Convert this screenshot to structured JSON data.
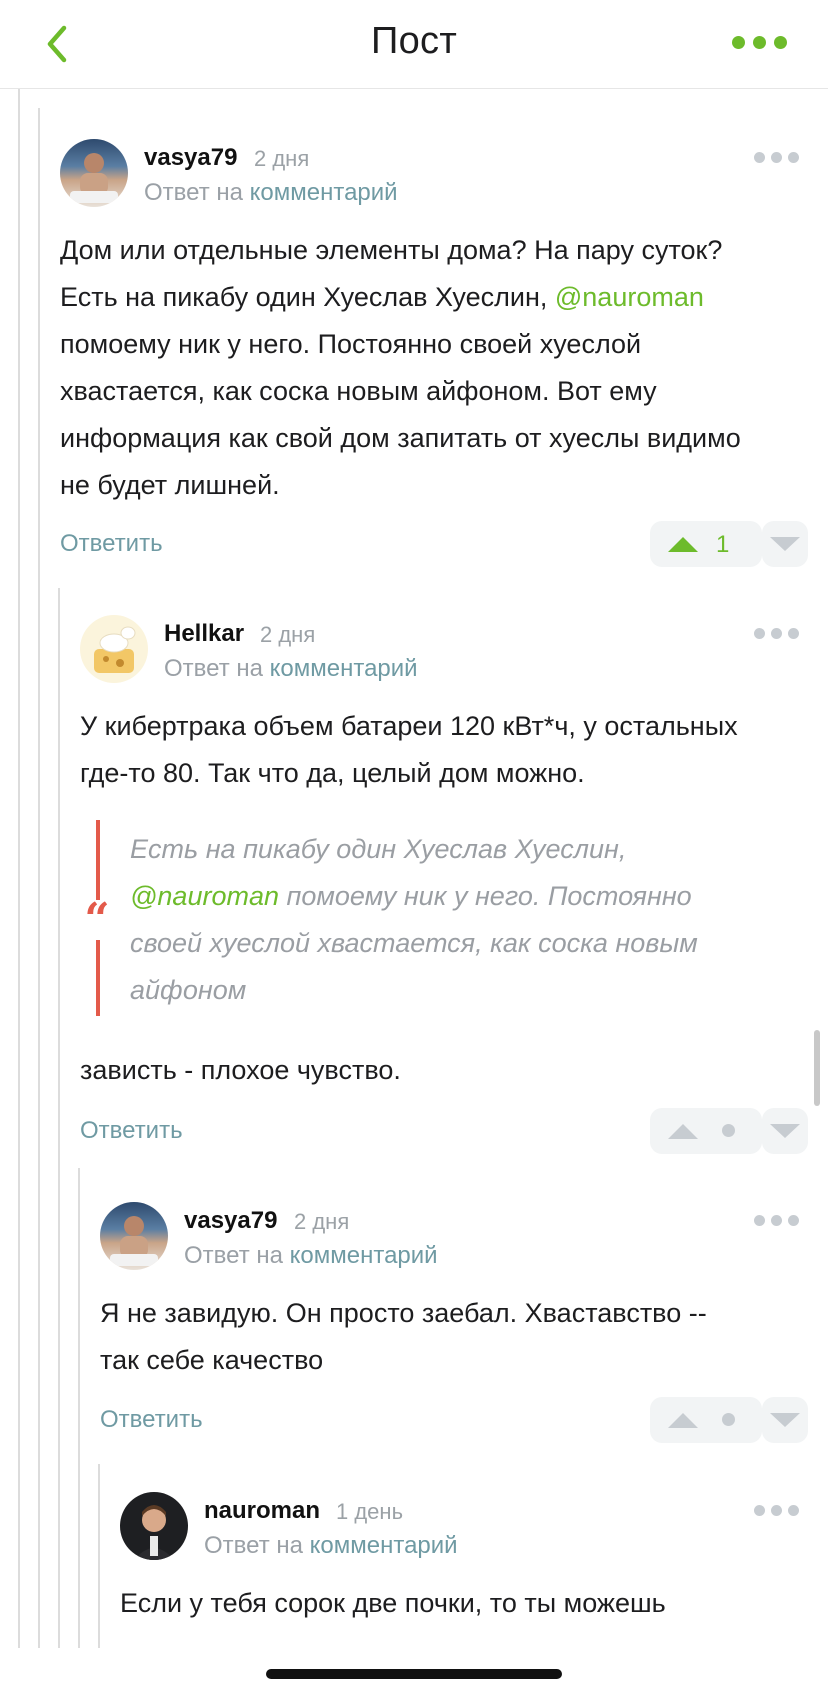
{
  "header": {
    "title": "Пост"
  },
  "colors": {
    "accent": "#6dbb2b",
    "quote_bar": "#e35a4a",
    "link": "#6f9aa3"
  },
  "comments": [
    {
      "username": "vasya79",
      "date": "2 дня",
      "reply_prefix": "Ответ на",
      "reply_link": "комментарий",
      "body_lines": [
        "Дом или отдельные элементы дома? На пару суток?",
        "Есть на пикабу один Хуеслав Хуеслин,",
        "помоему ник у него. Постоянно своей хуеслой",
        "хвастается, как соска новым айфоном. Вот ему",
        "информация как свой дом запитать от хуеслы видимо",
        "не будет лишней."
      ],
      "mention": "@nauroman",
      "reply_label": "Ответить",
      "rating": "1"
    },
    {
      "username": "Hellkar",
      "date": "2 дня",
      "reply_prefix": "Ответ на",
      "reply_link": "комментарий",
      "body_lines": [
        "У кибертрака объем батареи 120 кВт*ч, у остальных",
        "где-то 80. Так что да, целый дом можно."
      ],
      "quote": {
        "line1": "Есть на пикабу один Хуеслав Хуеслин,",
        "mention": "@nauroman",
        "line2_rest": " помоему ник у него. Постоянно",
        "line3": "своей хуеслой хвастается, как соска новым",
        "line4": "айфоном"
      },
      "after_quote": "зависть - плохое чувство.",
      "reply_label": "Ответить"
    },
    {
      "username": "vasya79",
      "date": "2 дня",
      "reply_prefix": "Ответ на",
      "reply_link": "комментарий",
      "body_lines": [
        "Я не завидую. Он просто заебал. Хваставство --",
        "так себе качество"
      ],
      "reply_label": "Ответить"
    },
    {
      "username": "nauroman",
      "date": "1 день",
      "reply_prefix": "Ответ на",
      "reply_link": "комментарий",
      "body_lines": [
        "Если у тебя сорок две почки, то ты можешь"
      ]
    }
  ]
}
